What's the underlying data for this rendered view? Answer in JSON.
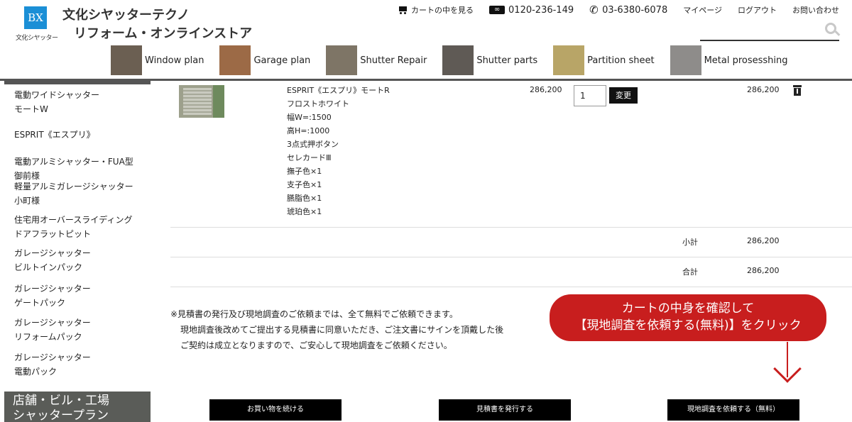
{
  "header": {
    "logo_mark": "BX",
    "logo_sub": "文化シヤッター",
    "title_line1": "文化シヤッターテクノ",
    "title_line2": "リフォーム・オンラインストア",
    "cart_link": "カートの中を見る",
    "free_dial": "0120-236-149",
    "phone": "03-6380-6078",
    "mypage": "マイページ",
    "logout": "ログアウト",
    "contact": "お問い合わせ",
    "search_placeholder": ""
  },
  "nav": {
    "items": [
      {
        "label": "Window plan",
        "thumb_color": "#6b5f52"
      },
      {
        "label": "Garage plan",
        "thumb_color": "#9c6a46"
      },
      {
        "label": "Shutter Repair",
        "thumb_color": "#7e7566"
      },
      {
        "label": "Shutter parts",
        "thumb_color": "#5f5a55"
      },
      {
        "label": "Partition sheet",
        "thumb_color": "#b8a567"
      },
      {
        "label": "Metal prosesshing",
        "thumb_color": "#8e8c8a"
      }
    ]
  },
  "sidebar": {
    "items": [
      "電動ワイドシャッター\nモートW",
      "ESPRIT《エスプリ》",
      "電動アルミシャッター・FUA型\n御前様",
      "軽量アルミガレージシャッター\n小町様",
      "住宅用オーバースライディング\nドアフラットピット",
      "ガレージシャッター\nビルトインパック",
      "ガレージシャッター\nゲートパック",
      "ガレージシャッター\nリフォームパック",
      "ガレージシャッター\n電動パック"
    ],
    "banner": "店舗・ビル・工場\nシャッタープラン"
  },
  "cart": {
    "product": {
      "name": "ESPRIT《エスプリ》モートR",
      "options": [
        "フロストホワイト",
        "幅W=:1500",
        "高H=:1000",
        "3点式押ボタン",
        "セレカードⅢ",
        "撫子色×1",
        "支子色×1",
        "臙脂色×1",
        "琥珀色×1"
      ],
      "unit_price": "286,200",
      "quantity": "1",
      "update_label": "変更",
      "line_total": "286,200"
    },
    "subtotal_label": "小計",
    "subtotal_value": "286,200",
    "total_label": "合計",
    "total_value": "286,200"
  },
  "notice": {
    "line1": "※見積書の発行及び現地調査のご依頼までは、全て無料でご依頼できます。",
    "line2": "現地調査後改めてご提出する見積書に同意いただき、ご注文書にサインを頂戴した後",
    "line3": "ご契約は成立となりますので、ご安心して現地調査をご依頼ください。"
  },
  "callout": {
    "line1": "カートの中身を確認して",
    "line2": "【現地調査を依頼する(無料)】をクリック"
  },
  "buttons": {
    "continue": "お買い物を続ける",
    "estimate": "見積書を発行する",
    "survey": "現地調査を依頼する（無料）"
  },
  "colors": {
    "brand_blue": "#1b8fd6",
    "callout_red": "#c81e1e",
    "button_black": "#000000",
    "banner_gray": "#5a5c58"
  }
}
